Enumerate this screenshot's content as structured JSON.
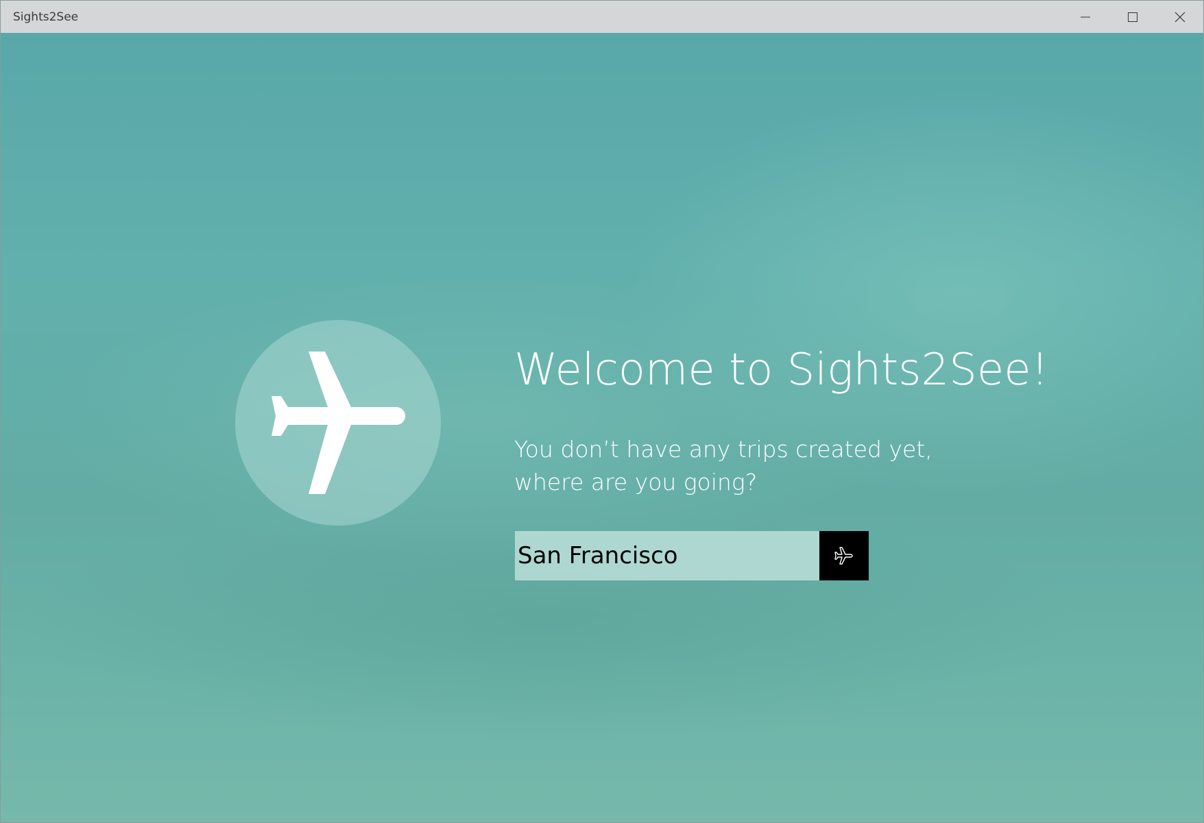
{
  "window": {
    "title": "Sights2See"
  },
  "main": {
    "welcome_title": "Welcome to Sights2See!",
    "subtitle_line1": "You don’t have any trips created yet,",
    "subtitle_line2": "where are you going?",
    "search": {
      "value": "San Francisco"
    },
    "go_button_icon": "airplane-icon",
    "hero_icon": "airplane-icon"
  },
  "colors": {
    "background": "#5fa9a8",
    "titlebar": "#d4d6d8",
    "button": "#000000",
    "text": "#ffffff"
  }
}
